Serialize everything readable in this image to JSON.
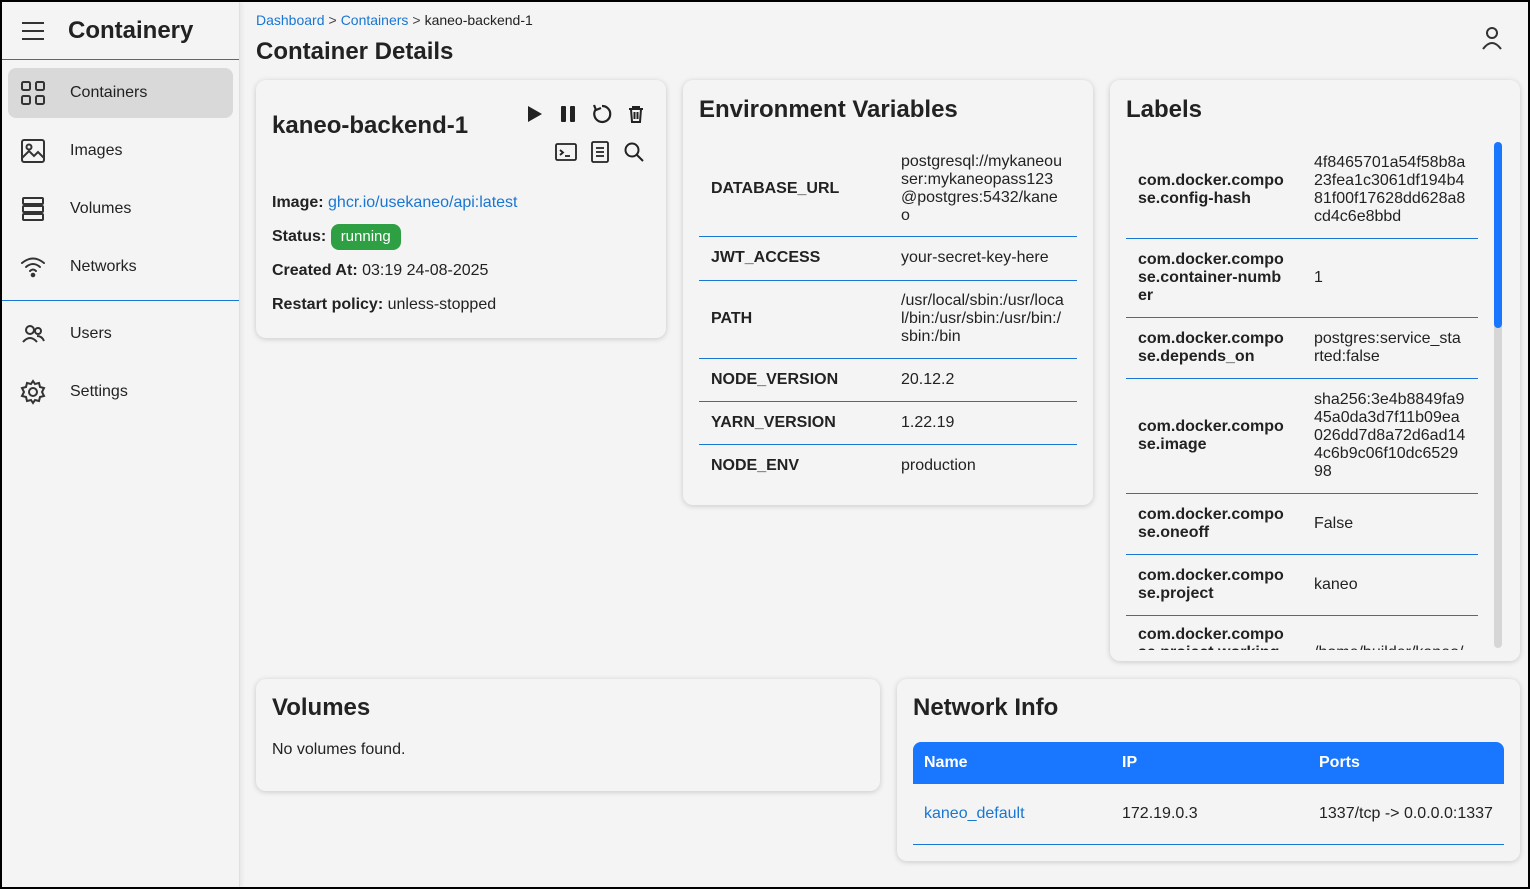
{
  "app": {
    "title": "Containery"
  },
  "sidebar": {
    "items": [
      {
        "label": "Containers",
        "icon": "grid-icon"
      },
      {
        "label": "Images",
        "icon": "image-icon"
      },
      {
        "label": "Volumes",
        "icon": "stack-icon"
      },
      {
        "label": "Networks",
        "icon": "wifi-icon"
      }
    ],
    "items2": [
      {
        "label": "Users",
        "icon": "users-icon"
      },
      {
        "label": "Settings",
        "icon": "gear-icon"
      }
    ]
  },
  "breadcrumb": {
    "dashboard": "Dashboard",
    "containers": "Containers",
    "current": "kaneo-backend-1",
    "sep": ">"
  },
  "page": {
    "title": "Container Details"
  },
  "container": {
    "name": "kaneo-backend-1",
    "image_label": "Image:",
    "image": "ghcr.io/usekaneo/api:latest",
    "status_label": "Status:",
    "status": "running",
    "created_label": "Created At:",
    "created": "03:19 24-08-2025",
    "restart_label": "Restart policy:",
    "restart": "unless-stopped"
  },
  "env": {
    "title": "Environment Variables",
    "rows": [
      {
        "key": "DATABASE_URL",
        "value": "postgresql://mykaneouser:mykaneopass123@postgres:5432/kaneo"
      },
      {
        "key": "JWT_ACCESS",
        "value": "your-secret-key-here"
      },
      {
        "key": "PATH",
        "value": "/usr/local/sbin:/usr/local/bin:/usr/sbin:/usr/bin:/sbin:/bin"
      },
      {
        "key": "NODE_VERSION",
        "value": "20.12.2"
      },
      {
        "key": "YARN_VERSION",
        "value": "1.22.19"
      },
      {
        "key": "NODE_ENV",
        "value": "production"
      }
    ]
  },
  "labels": {
    "title": "Labels",
    "rows": [
      {
        "key": "com.docker.compose.config-hash",
        "value": "4f8465701a54f58b8a23fea1c3061df194b481f00f17628dd628a8cd4c6e8bbd"
      },
      {
        "key": "com.docker.compose.container-number",
        "value": "1"
      },
      {
        "key": "com.docker.compose.depends_on",
        "value": "postgres:service_started:false"
      },
      {
        "key": "com.docker.compose.image",
        "value": "sha256:3e4b8849fa945a0da3d7f11b09ea026dd7d8a72d6ad144c6b9c06f10dc652998"
      },
      {
        "key": "com.docker.compose.oneoff",
        "value": "False"
      },
      {
        "key": "com.docker.compose.project",
        "value": "kaneo"
      },
      {
        "key": "com.docker.compose.project.working_dir",
        "value": "/home/builder/kaneo/"
      }
    ]
  },
  "volumes": {
    "title": "Volumes",
    "empty": "No volumes found."
  },
  "network": {
    "title": "Network Info",
    "headers": {
      "name": "Name",
      "ip": "IP",
      "ports": "Ports"
    },
    "rows": [
      {
        "name": "kaneo_default",
        "ip": "172.19.0.3",
        "ports": "1337/tcp -> 0.0.0.0:1337"
      }
    ]
  },
  "colors": {
    "accent": "#1976d2",
    "status_running": "#2ea043",
    "table_header": "#1976ff"
  }
}
